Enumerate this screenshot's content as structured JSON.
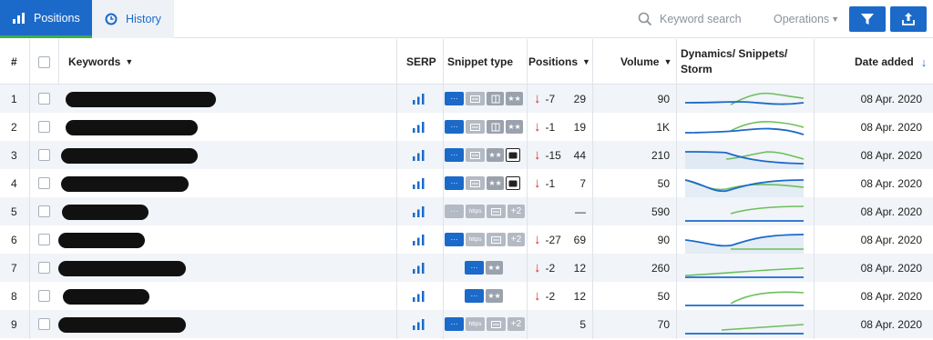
{
  "tabs": {
    "positions": "Positions",
    "history": "History"
  },
  "search": {
    "placeholder": "Keyword search"
  },
  "operations": {
    "label": "Operations"
  },
  "columns": {
    "num": "#",
    "keywords": "Keywords",
    "serp": "SERP",
    "snippet": "Snippet type",
    "positions": "Positions",
    "volume": "Volume",
    "dynamics": "Dynamics/ Snippets/ Storm",
    "date": "Date added"
  },
  "colors": {
    "accent": "#1b6ac9",
    "green": "#3cae4a",
    "red": "#d93025"
  },
  "snippet_icons": {
    "dots": "···",
    "card": "card-icon",
    "book": "book-icon",
    "stars": "★★",
    "video": "video-icon",
    "https": "https",
    "more": "+2"
  },
  "rows": [
    {
      "num": "1",
      "change": "-7",
      "position": "29",
      "volume": "90",
      "date": "08 Apr. 2020",
      "snippets": [
        "dots",
        "card",
        "book",
        "stars"
      ],
      "down": true
    },
    {
      "num": "2",
      "change": "-1",
      "position": "19",
      "volume": "1K",
      "date": "08 Apr. 2020",
      "snippets": [
        "dots",
        "card",
        "book",
        "stars"
      ],
      "down": true
    },
    {
      "num": "3",
      "change": "-15",
      "position": "44",
      "volume": "210",
      "date": "08 Apr. 2020",
      "snippets": [
        "dots",
        "card",
        "stars",
        "video"
      ],
      "down": true
    },
    {
      "num": "4",
      "change": "-1",
      "position": "7",
      "volume": "50",
      "date": "08 Apr. 2020",
      "snippets": [
        "dots",
        "card",
        "stars",
        "video"
      ],
      "down": true
    },
    {
      "num": "5",
      "change": "",
      "position": "—",
      "volume": "590",
      "date": "08 Apr. 2020",
      "snippets": [
        "dots-grey",
        "https",
        "card",
        "more"
      ],
      "down": false
    },
    {
      "num": "6",
      "change": "-27",
      "position": "69",
      "volume": "90",
      "date": "08 Apr. 2020",
      "snippets": [
        "dots",
        "https",
        "card",
        "more"
      ],
      "down": true
    },
    {
      "num": "7",
      "change": "-2",
      "position": "12",
      "volume": "260",
      "date": "08 Apr. 2020",
      "snippets": [
        "dots",
        "stars"
      ],
      "down": true
    },
    {
      "num": "8",
      "change": "-2",
      "position": "12",
      "volume": "50",
      "date": "08 Apr. 2020",
      "snippets": [
        "dots",
        "stars"
      ],
      "down": true
    },
    {
      "num": "9",
      "change": "",
      "position": "5",
      "volume": "70",
      "date": "08 Apr. 2020",
      "snippets": [
        "dots",
        "https",
        "card",
        "more"
      ],
      "down": false
    }
  ]
}
